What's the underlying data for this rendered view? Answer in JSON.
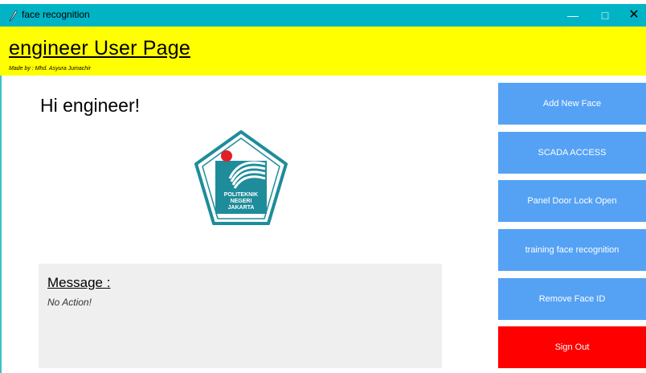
{
  "window": {
    "title": "face recognition",
    "titlebar_color": "#00b4c6",
    "controls": {
      "minimize": "—",
      "maximize": "□",
      "close": "✕"
    }
  },
  "header": {
    "title": "engineer User Page",
    "subtitle": "Made by : Mhd. Asyura Jumachir",
    "background": "#ffff00"
  },
  "main": {
    "greeting": "Hi engineer!",
    "logo": {
      "icon": "politeknik-negeri-jakarta-logo",
      "text_lines": [
        "POLITEKNIK",
        "NEGERI",
        "JAKARTA"
      ]
    },
    "message": {
      "label": "Message :",
      "text": "No Action!"
    }
  },
  "sidebar": {
    "accent": "#55a2f5",
    "danger": "#ff0000",
    "buttons": [
      {
        "label": "Add New Face"
      },
      {
        "label": "SCADA ACCESS"
      },
      {
        "label": "Panel Door Lock Open"
      },
      {
        "label": "training face recognition"
      },
      {
        "label": "Remove Face ID"
      },
      {
        "label": "Sign Out"
      }
    ]
  }
}
